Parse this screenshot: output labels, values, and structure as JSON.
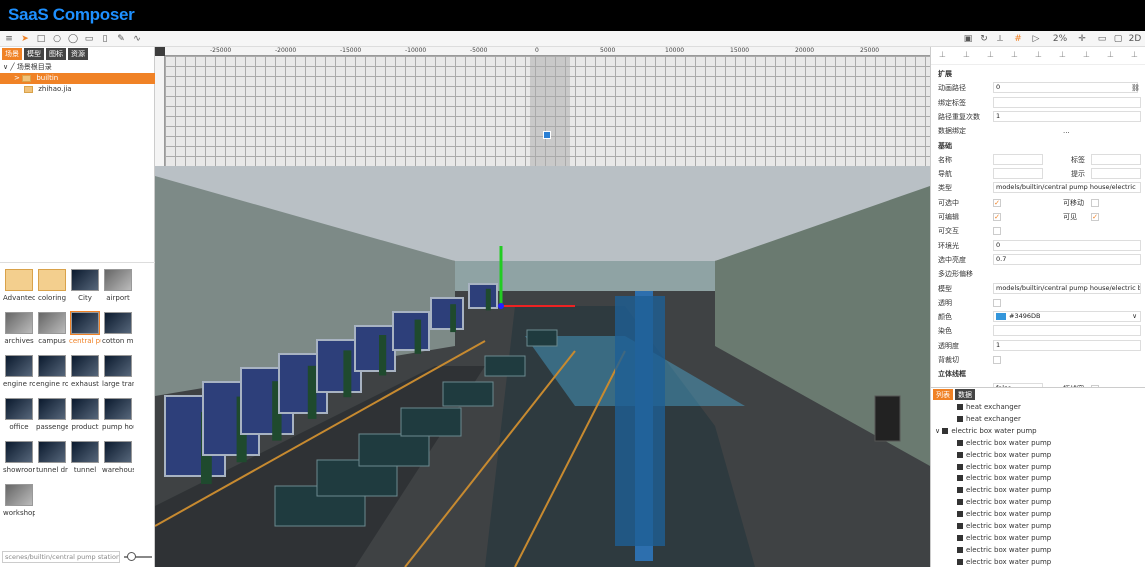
{
  "app": {
    "title": "SaaS Composer"
  },
  "toolbar": {
    "zoom": "2%",
    "view_mode": "2D"
  },
  "left_panel": {
    "tabs": [
      {
        "label": "场景"
      },
      {
        "label": "模型"
      },
      {
        "label": "图标"
      },
      {
        "label": "资源"
      }
    ],
    "tree": [
      {
        "label": "场景根目录"
      },
      {
        "label": "builtin"
      },
      {
        "label": "zhihao.jia"
      }
    ],
    "assets": [
      {
        "label": "Advantech"
      },
      {
        "label": "coloring"
      },
      {
        "label": "City"
      },
      {
        "label": "airport"
      },
      {
        "label": "archives"
      },
      {
        "label": "campus"
      },
      {
        "label": "central pump house"
      },
      {
        "label": "cotton mill"
      },
      {
        "label": "engine room"
      },
      {
        "label": "engine room"
      },
      {
        "label": "exhaust"
      },
      {
        "label": "large transformer"
      },
      {
        "label": "office"
      },
      {
        "label": "passenger"
      },
      {
        "label": "product"
      },
      {
        "label": "pump house"
      },
      {
        "label": "showroom"
      },
      {
        "label": "tunnel dr"
      },
      {
        "label": "tunnel"
      },
      {
        "label": "warehouse"
      },
      {
        "label": "workshop"
      }
    ],
    "path": "scenes/builtin/central pump station.json"
  },
  "ruler": {
    "ticks": [
      "-25000",
      "-20000",
      "-15000",
      "-10000",
      "-5000",
      "0",
      "5000",
      "10000",
      "15000",
      "20000",
      "25000"
    ]
  },
  "properties": {
    "ext_title": "扩展",
    "anim_path_label": "动画路径",
    "anim_path_value": "0",
    "bind_tag_label": "绑定标签",
    "bind_tag_value": "",
    "path_repeat_label": "路径重复次数",
    "path_repeat_value": "1",
    "data_bind_label": "数据绑定",
    "data_bind_value": "...",
    "basic_title": "基础",
    "name_label": "名称",
    "name_value": "",
    "tag_label": "标签",
    "tag_value": "",
    "nav_label": "导航",
    "nav_value": "",
    "hint_label": "提示",
    "hint_value": "",
    "type_label": "类型",
    "type_value": "models/builtin/central pump house/electric",
    "selectable_label": "可选中",
    "movable_label": "可移动",
    "editable_label": "可编辑",
    "visible_label": "可见",
    "interactive_label": "可交互",
    "ambient_label": "环境光",
    "ambient_value": "0",
    "select_bright_label": "选中亮度",
    "select_bright_value": "0.7",
    "poly_offset_label": "多边形偏移",
    "model_label": "模型",
    "model_value": "models/builtin/central pump house/electric box",
    "transparent_label": "透明",
    "color_label": "颜色",
    "color_value": "#3496DB",
    "tint_label": "染色",
    "tint_value": "",
    "opacity_label": "透明度",
    "opacity_value": "1",
    "clip_label": "背裁切",
    "solid_title": "立体线框",
    "solid_value": "false",
    "extra_label": "拓线宽"
  },
  "list_panel": {
    "tabs": [
      {
        "label": "列表"
      },
      {
        "label": "数据"
      }
    ],
    "rows": [
      {
        "label": "heat exchanger"
      },
      {
        "label": "heat exchanger"
      },
      {
        "label": "electric box water pump"
      },
      {
        "label": "electric box water pump"
      },
      {
        "label": "electric box water pump"
      },
      {
        "label": "electric box water pump"
      },
      {
        "label": "electric box water pump"
      },
      {
        "label": "electric box water pump"
      },
      {
        "label": "electric box water pump"
      },
      {
        "label": "electric box water pump"
      },
      {
        "label": "electric box water pump"
      },
      {
        "label": "electric box water pump"
      },
      {
        "label": "electric box water pump"
      },
      {
        "label": "electric box water pump"
      },
      {
        "label": "electric box water pump"
      }
    ]
  },
  "colors": {
    "accent": "#f08226",
    "brand": "#1e90ff",
    "swatch": "#3496DB"
  }
}
